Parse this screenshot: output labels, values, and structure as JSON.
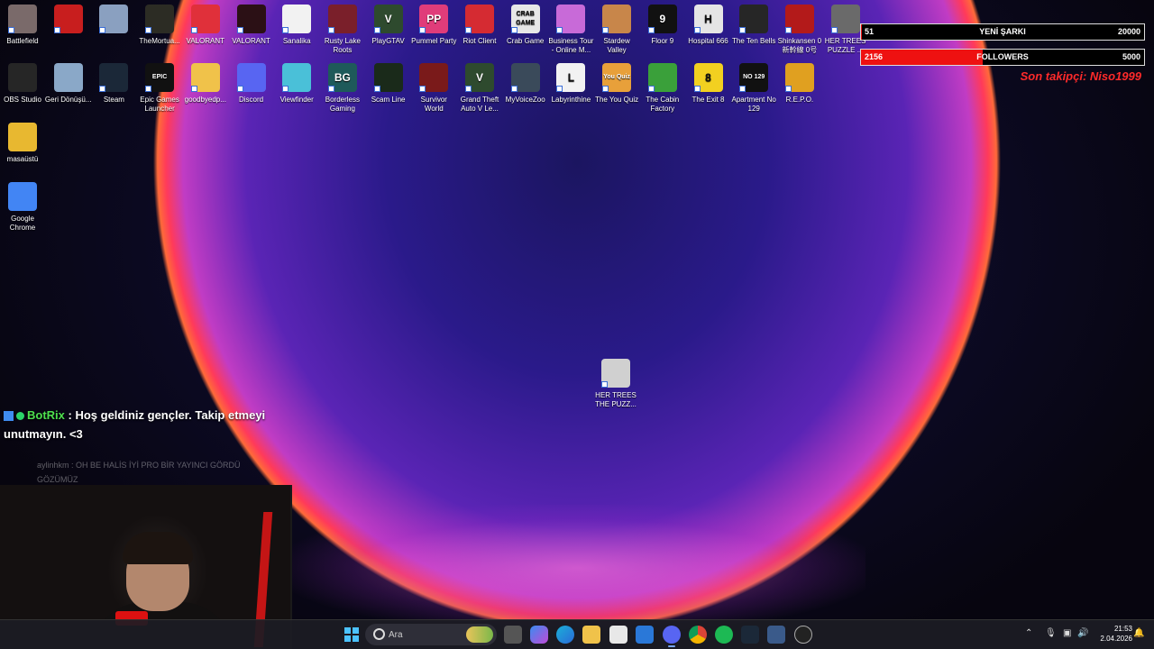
{
  "desktop": {
    "icons_row1": [
      {
        "label": "Battlefield",
        "icon": "battlefield-game-icon",
        "color": "#7a6a6a"
      },
      {
        "label": "",
        "icon": "red-game-icon",
        "color": "#c81e1e"
      },
      {
        "label": "",
        "icon": "character-game-icon",
        "color": "#8aa0c0"
      },
      {
        "label": "TheMortua...",
        "icon": "mortuary-game-icon",
        "color": "#2c2c24"
      },
      {
        "label": "VALORANT",
        "icon": "riot-valorant-icon",
        "color": "#e0303a"
      },
      {
        "label": "VALORANT",
        "icon": "valorant-logo-icon",
        "color": "#2b1015"
      },
      {
        "label": "Sanalika",
        "icon": "sanalika-icon",
        "color": "#f2f2f2"
      },
      {
        "label": "Rusty Lake Roots",
        "icon": "tree-icon",
        "color": "#7a1f2a"
      },
      {
        "label": "PlayGTAV",
        "icon": "gta-v-icon",
        "color": "#2e4a2e"
      },
      {
        "label": "Pummel Party",
        "icon": "pummel-party-icon",
        "color": "#e03c7a"
      },
      {
        "label": "Riot Client",
        "icon": "riot-client-icon",
        "color": "#d52b32"
      },
      {
        "label": "Crab Game",
        "icon": "crab-game-icon",
        "color": "#e7e7e7"
      },
      {
        "label": "Business Tour - Online M...",
        "icon": "business-tour-icon",
        "color": "#c86ad8"
      },
      {
        "label": "Stardew Valley",
        "icon": "stardew-chicken-icon",
        "color": "#c8864a"
      },
      {
        "label": "Floor 9",
        "icon": "floor-9-icon",
        "color": "#111111"
      },
      {
        "label": "Hospital 666",
        "icon": "hospital-666-icon",
        "color": "#e5e5e5"
      },
      {
        "label": "The Ten Bells",
        "icon": "bell-icon",
        "color": "#262626"
      },
      {
        "label": "Shinkansen 0 新幹線 0号",
        "icon": "shinkansen-icon",
        "color": "#b31a1a"
      },
      {
        "label": "HER TREES PUZZLE ...",
        "icon": "her-trees-icon",
        "color": "#6a6a6a"
      }
    ],
    "icons_row2": [
      {
        "label": "OBS Studio",
        "icon": "obs-icon",
        "color": "#262626"
      },
      {
        "label": "Geri Dönüşü...",
        "icon": "recycle-bin-icon",
        "color": "#8aa8c8"
      },
      {
        "label": "Steam",
        "icon": "steam-icon",
        "color": "#1b2838"
      },
      {
        "label": "Epic Games Launcher",
        "icon": "epic-games-icon",
        "color": "#111111"
      },
      {
        "label": "goodbyedp...",
        "icon": "folder-icon",
        "color": "#f0c24a"
      },
      {
        "label": "Discord",
        "icon": "discord-icon",
        "color": "#5865f2"
      },
      {
        "label": "Viewfinder",
        "icon": "viewfinder-icon",
        "color": "#4ac0d8"
      },
      {
        "label": "Borderless Gaming",
        "icon": "borderless-gaming-icon",
        "color": "#1e5a5a"
      },
      {
        "label": "Scam Line",
        "icon": "scam-line-icon",
        "color": "#1a2a1a"
      },
      {
        "label": "Survivor World",
        "icon": "survivor-world-icon",
        "color": "#7a1a1a"
      },
      {
        "label": "Grand Theft Auto V Le...",
        "icon": "gta-v-legacy-icon",
        "color": "#2e4a2e"
      },
      {
        "label": "MyVoiceZoo",
        "icon": "penguin-icon",
        "color": "#3a4a5a"
      },
      {
        "label": "Labyrinthine",
        "icon": "labyrinthine-icon",
        "color": "#f2f2f2"
      },
      {
        "label": "The You Quiz",
        "icon": "you-quiz-icon",
        "color": "#e8a03a"
      },
      {
        "label": "The Cabin Factory",
        "icon": "frog-icon",
        "color": "#3aa03a"
      },
      {
        "label": "The Exit 8",
        "icon": "exit-8-icon",
        "color": "#f2d020"
      },
      {
        "label": "Apartment No 129",
        "icon": "apartment-129-icon",
        "color": "#111111"
      },
      {
        "label": "R.E.P.O.",
        "icon": "repo-icon",
        "color": "#e0a020"
      }
    ],
    "icons_col": [
      {
        "label": "masaüstü",
        "icon": "folder-icon",
        "color": "#e8b830"
      },
      {
        "label": "Google Chrome",
        "icon": "chrome-icon",
        "color": "#4285f4"
      }
    ],
    "center_icon": {
      "label": "HER TREES THE PUZZ...",
      "icon": "her-trees-puzzle-icon",
      "color": "#d0d0d0"
    },
    "glyphs": {
      "Epic Games Launcher": "EPIC",
      "Borderless Gaming": "BG",
      "Labyrinthine": "L",
      "The You Quiz": "You Quiz",
      "The Exit 8": "8",
      "Apartment No 129": "NO 129",
      "Floor 9": "9",
      "Hospital 666": "H",
      "Crab Game": "CRAB GAME",
      "Pummel Party": "PP",
      "PlayGTAV": "V",
      "Grand Theft Auto V Le...": "V"
    }
  },
  "overlay": {
    "bar1": {
      "current": "51",
      "label": "YENİ ŞARKI",
      "goal": "20000",
      "progress": 0.0026
    },
    "bar2": {
      "current": "2156",
      "label": "FOLLOWERS",
      "goal": "5000",
      "progress": 0.4312
    },
    "last_follower": "Son takipçi: Niso1999",
    "bar_fill_color": "#ee1111"
  },
  "chat": {
    "message": {
      "user": "BotRix",
      "text": ": Hoş geldiniz gençler. Takip etmeyi unutmayın. <3"
    },
    "faded": "aylinhkm : OH BE HALİS İYİ PRO BİR YAYINCI GÖRDÜ GÖZÜMÜZ"
  },
  "taskbar": {
    "search_placeholder": "Ara",
    "time": "21:53",
    "date": "2.04.2026",
    "icons": [
      "windows-start-icon",
      "search-icon",
      "file-manager-icon",
      "copilot-icon",
      "edge-icon",
      "folder-icon",
      "store-icon",
      "mail-icon",
      "discord-icon",
      "chrome-icon",
      "spotify-icon",
      "steam-icon",
      "steam-tools-icon",
      "obs-icon"
    ],
    "tray": [
      "chevron-up-icon",
      "microphone-icon",
      "network-icon",
      "volume-icon",
      "notification-icon"
    ]
  }
}
